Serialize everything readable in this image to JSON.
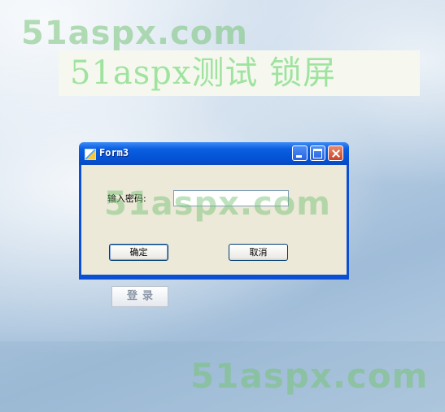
{
  "watermarks": {
    "top": "51aspx.com",
    "middle": "51aspx.com",
    "bottom": "51aspx.com"
  },
  "banner": {
    "text": "51aspx测试 锁屏"
  },
  "window": {
    "title": "Form3",
    "password_label": "输入密码:",
    "password_value": "",
    "ok_label": "确定",
    "cancel_label": "取消"
  },
  "login_button": {
    "label": "登录"
  },
  "colors": {
    "title_bar": "#0453d6",
    "client_bg": "#ece9d8",
    "watermark": "#78c378",
    "banner_text": "#9fe39f"
  }
}
